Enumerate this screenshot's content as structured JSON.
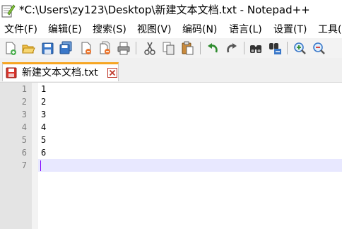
{
  "window": {
    "title": "*C:\\Users\\zy123\\Desktop\\新建文本文档.txt - Notepad++"
  },
  "menu": [
    "文件(F)",
    "编辑(E)",
    "搜索(S)",
    "视图(V)",
    "编码(N)",
    "语言(L)",
    "设置(T)",
    "工具("
  ],
  "toolbar": {
    "buttons": [
      "new-file",
      "open-file",
      "save",
      "save-all",
      "close",
      "close-all",
      "print",
      "cut",
      "copy",
      "paste",
      "undo",
      "redo",
      "find",
      "replace",
      "zoom-in",
      "zoom-out"
    ]
  },
  "tabs": [
    {
      "label": "新建文本文档.txt",
      "modified": true
    }
  ],
  "editor": {
    "line_numbers": [
      "1",
      "2",
      "3",
      "4",
      "5",
      "6",
      "7"
    ],
    "lines": [
      "1",
      "2",
      "3",
      "4",
      "5",
      "6",
      ""
    ],
    "current_line": 7
  },
  "colors": {
    "tab_accent": "#f6a623",
    "gutter_bg": "#e4e4e4",
    "current_line_bg": "#e8e8ff",
    "caret": "#8000ff"
  }
}
